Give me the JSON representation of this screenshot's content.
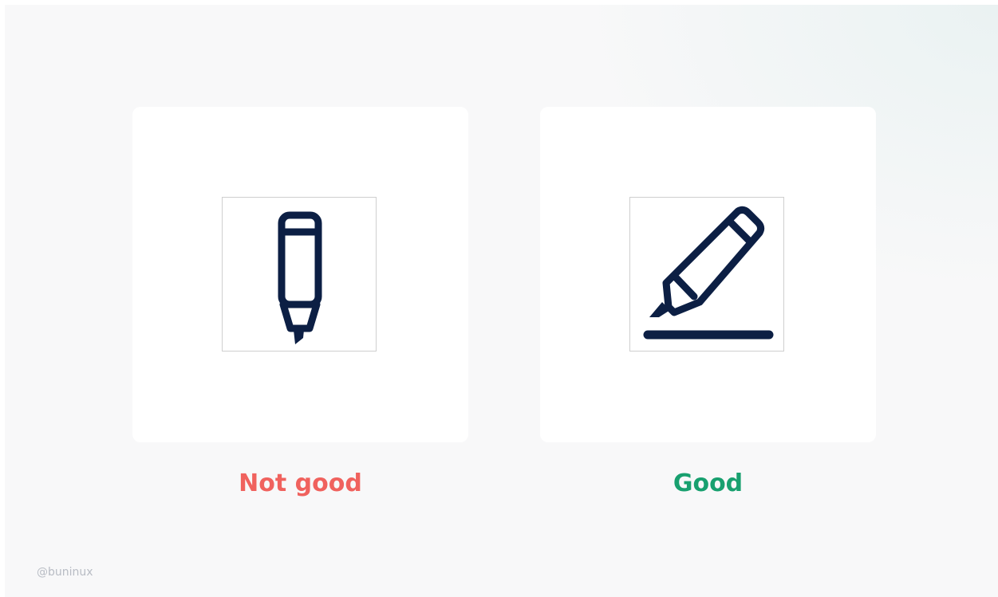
{
  "comparison": {
    "bad": {
      "label": "Not good",
      "label_color": "#f0625e",
      "icon": "marker-pen-icon"
    },
    "good": {
      "label": "Good",
      "label_color": "#18a06f",
      "icon": "edit-pencil-icon"
    }
  },
  "icon_color": "#0c1f44",
  "credit": "@buninux"
}
